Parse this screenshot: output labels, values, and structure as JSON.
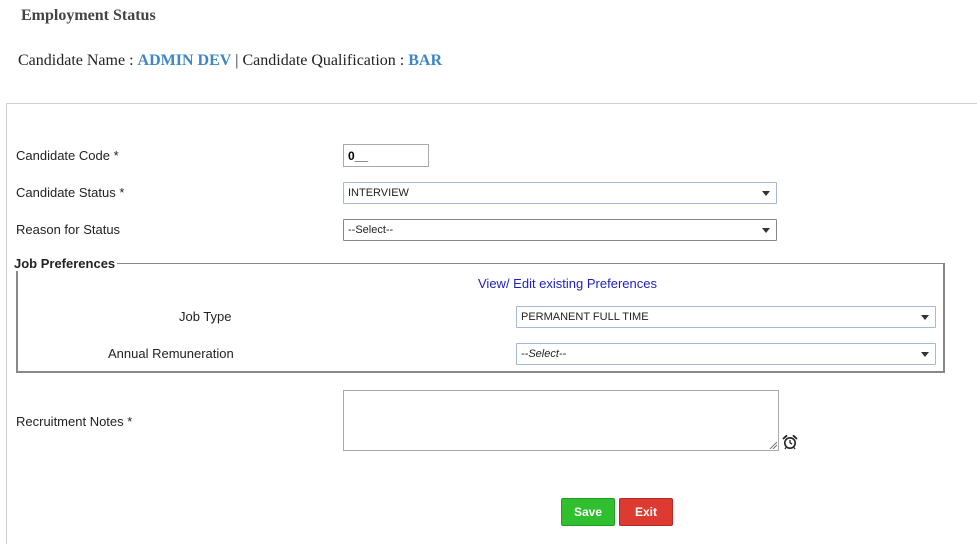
{
  "header": {
    "title": "Employment Status",
    "candidate_name_label": "Candidate Name : ",
    "candidate_name": "ADMIN DEV",
    "separator": " | ",
    "qualification_label": "Candidate Qualification : ",
    "qualification": "BAR"
  },
  "form": {
    "candidate_code_label": "Candidate Code *",
    "candidate_code_value": "0__",
    "candidate_status_label": "Candidate Status *",
    "candidate_status_value": "INTERVIEW",
    "reason_label": "Reason for Status",
    "reason_value": "--Select--",
    "job_preferences": {
      "legend": "Job Preferences",
      "view_edit_link": "View/ Edit existing Preferences",
      "job_type_label": "Job Type",
      "job_type_value": "PERMANENT FULL TIME",
      "remuneration_label": "Annual Remuneration",
      "remuneration_value": "--Select--"
    },
    "notes_label": "Recruitment Notes *",
    "notes_value": ""
  },
  "actions": {
    "save_label": "Save",
    "exit_label": "Exit"
  },
  "icons": {
    "alarm": "alarm-clock-icon",
    "caret": "chevron-down-icon"
  },
  "colors": {
    "link_blue": "#3f86c8",
    "save_green": "#2fbf2f",
    "exit_red": "#dd3b32"
  }
}
